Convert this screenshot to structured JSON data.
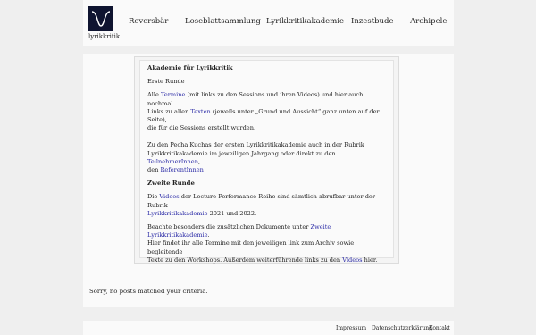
{
  "header": {
    "logo_text": "lyrikkritik",
    "nav": [
      "Reversbär",
      "Loseblattsammlung",
      "Lyrikkritikakademie",
      "Inzestbude",
      "Archipele"
    ]
  },
  "article": {
    "title": "Akademie für Lyrikkritik",
    "round1": "Erste Runde",
    "p1": {
      "a": "Alle ",
      "link1": "Termine",
      "b": " (mit links zu den Sessions und ihren Videos) und hier auch nochmal",
      "c": "Links zu allen ",
      "link2": "Texten",
      "d": " (jeweils unter „Grund und Aussicht“ ganz unten auf der Seite),",
      "e": "die für die Sessions erstellt wurden."
    },
    "p2": {
      "a": "Zu den Pecha Kuchas der ersten Lyrikkritikakademie auch in der Rubrik",
      "b": "Lyrikkritikakademie im jeweiligen Jahrgang oder direkt zu den ",
      "link1": "TeilnehmerInnen",
      "c": ",",
      "d": "den ",
      "link2": "ReferentInnen"
    },
    "round2": "Zweite Runde",
    "p3": {
      "a": "Die ",
      "link1": "Videos",
      "b": " der Lecture-Performance-Reihe sind sämtlich abrufbar unter der Rubrik",
      "link2": "Lyrikkritikakademie",
      "c": " 2021 und 2022."
    },
    "p4": {
      "a": "Beachte besonders die zusätzlichen Dokumente unter ",
      "link1": "Zweite Lyrikkritikakademie",
      "b": ".",
      "c": "Hier findet ihr alle Termine mit den jeweiligen link zum Archiv sowie begleitende",
      "d": "Texte zu den Workshops. Außerdem weiterführende links zu den ",
      "link2": "Videos",
      "e": " hier."
    }
  },
  "status": "Sorry, no posts matched your criteria.",
  "footer": [
    "Impressum",
    "Datenschutzerklärung",
    "Kontakt"
  ],
  "colors": {
    "link": "#2a2aa6",
    "logo_bg": "#0f1430"
  }
}
